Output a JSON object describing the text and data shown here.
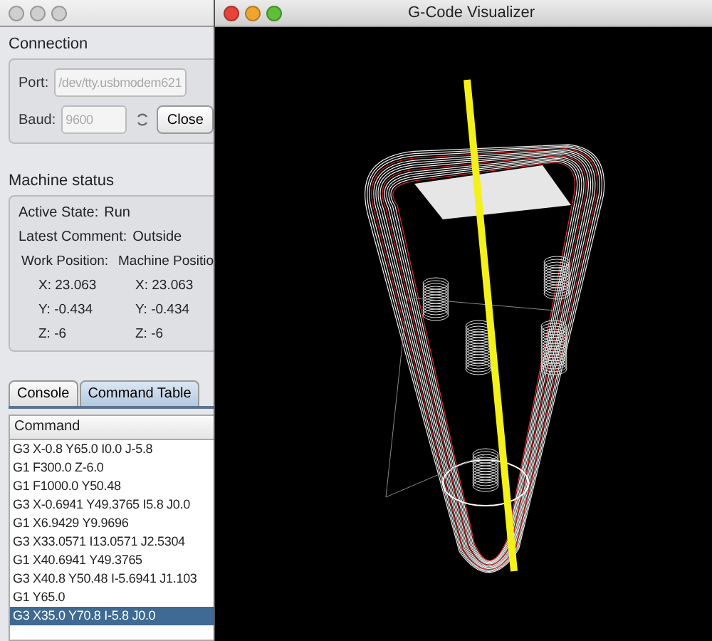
{
  "left_window": {
    "connection": {
      "title": "Connection",
      "port_label": "Port:",
      "port_value": "/dev/tty.usbmodem621",
      "port_disabled": true,
      "baud_label": "Baud:",
      "baud_value": "9600",
      "baud_disabled": true,
      "close_button": "Close"
    },
    "machine_status": {
      "title": "Machine status",
      "active_state_label": "Active State:",
      "active_state": "Run",
      "latest_comment_label": "Latest Comment:",
      "latest_comment": "Outside",
      "work_position_label": "Work Position:",
      "machine_position_label": "Machine Positio",
      "work": [
        {
          "axis": "X:",
          "value": "23.063"
        },
        {
          "axis": "Y:",
          "value": "-0.434"
        },
        {
          "axis": "Z:",
          "value": "-6"
        }
      ],
      "machine": [
        {
          "axis": "X:",
          "value": "23.063"
        },
        {
          "axis": "Y:",
          "value": "-0.434"
        },
        {
          "axis": "Z:",
          "value": "-6"
        }
      ]
    },
    "tabs": [
      {
        "label": "Console",
        "selected": false
      },
      {
        "label": "Command Table",
        "selected": true
      }
    ],
    "table": {
      "columns": [
        "Command"
      ],
      "rows": [
        {
          "command": "G3 X-0.8 Y65.0 I0.0 J-5.8",
          "selected": false
        },
        {
          "command": "G1 F300.0 Z-6.0",
          "selected": false
        },
        {
          "command": "G1 F1000.0 Y50.48",
          "selected": false
        },
        {
          "command": "G3 X-0.6941 Y49.3765 I5.8 J0.0",
          "selected": false
        },
        {
          "command": "G1 X6.9429 Y9.9696",
          "selected": false
        },
        {
          "command": "G3 X33.0571 I13.0571 J2.5304",
          "selected": false
        },
        {
          "command": "G1 X40.6941 Y49.3765",
          "selected": false
        },
        {
          "command": "G3 X40.8 Y50.48 I-5.6941 J1.103",
          "selected": false
        },
        {
          "command": "G1 Y65.0",
          "selected": false
        },
        {
          "command": "G3 X35.0 Y70.8 I-5.8 J0.0",
          "selected": true
        }
      ]
    }
  },
  "visualizer": {
    "title": "G-Code Visualizer"
  }
}
